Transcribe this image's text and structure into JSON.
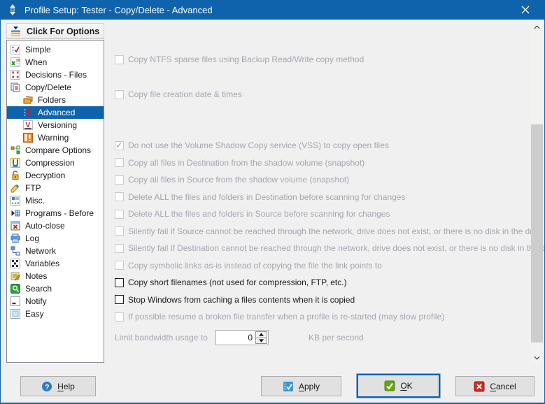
{
  "window": {
    "title": "Profile Setup: Tester - Copy/Delete - Advanced"
  },
  "options_button": {
    "label": "Click For Options"
  },
  "sidebar": {
    "items": [
      {
        "label": "Simple",
        "icon": "simple-icon",
        "indent": 0,
        "selected": false
      },
      {
        "label": "When",
        "icon": "when-icon",
        "indent": 0,
        "selected": false
      },
      {
        "label": "Decisions - Files",
        "icon": "decisions-files-icon",
        "indent": 0,
        "selected": false
      },
      {
        "label": "Copy/Delete",
        "icon": "copy-delete-icon",
        "indent": 0,
        "selected": false
      },
      {
        "label": "Folders",
        "icon": "folders-icon",
        "indent": 1,
        "selected": false
      },
      {
        "label": "Advanced",
        "icon": "advanced-icon",
        "indent": 1,
        "selected": true
      },
      {
        "label": "Versioning",
        "icon": "versioning-icon",
        "indent": 1,
        "selected": false
      },
      {
        "label": "Warning",
        "icon": "warning-icon",
        "indent": 1,
        "selected": false
      },
      {
        "label": "Compare Options",
        "icon": "compare-options-icon",
        "indent": 0,
        "selected": false
      },
      {
        "label": "Compression",
        "icon": "compression-icon",
        "indent": 0,
        "selected": false
      },
      {
        "label": "Decryption",
        "icon": "decryption-icon",
        "indent": 0,
        "selected": false
      },
      {
        "label": "FTP",
        "icon": "ftp-icon",
        "indent": 0,
        "selected": false
      },
      {
        "label": "Misc.",
        "icon": "misc-icon",
        "indent": 0,
        "selected": false
      },
      {
        "label": "Programs - Before",
        "icon": "programs-before-icon",
        "indent": 0,
        "selected": false
      },
      {
        "label": "Auto-close",
        "icon": "auto-close-icon",
        "indent": 0,
        "selected": false
      },
      {
        "label": "Log",
        "icon": "log-icon",
        "indent": 0,
        "selected": false
      },
      {
        "label": "Network",
        "icon": "network-icon",
        "indent": 0,
        "selected": false
      },
      {
        "label": "Variables",
        "icon": "variables-icon",
        "indent": 0,
        "selected": false
      },
      {
        "label": "Notes",
        "icon": "notes-icon",
        "indent": 0,
        "selected": false
      },
      {
        "label": "Search",
        "icon": "search-icon",
        "indent": 0,
        "selected": false
      },
      {
        "label": "Notify",
        "icon": "notify-icon",
        "indent": 0,
        "selected": false
      },
      {
        "label": "Easy",
        "icon": "easy-icon",
        "indent": 0,
        "selected": false
      }
    ]
  },
  "options": [
    {
      "label": "Copy NTFS sparse files using Backup Read/Write copy method",
      "checked": false,
      "enabled": false,
      "group": 1
    },
    {
      "label": "Copy file creation date & times",
      "checked": false,
      "enabled": false,
      "group": 2
    },
    {
      "label": "Do not use the Volume Shadow Copy service (VSS) to copy open files",
      "checked": true,
      "enabled": false,
      "group": 3
    },
    {
      "label": "Copy all files in Destination from the shadow volume (snapshot)",
      "checked": false,
      "enabled": false,
      "group": 3
    },
    {
      "label": "Copy all files in Source from the shadow volume (snapshot)",
      "checked": false,
      "enabled": false,
      "group": 3
    },
    {
      "label": "Delete ALL the files and folders in Destination before scanning for changes",
      "checked": false,
      "enabled": false,
      "group": 3
    },
    {
      "label": "Delete ALL the files and folders in Source before scanning for changes",
      "checked": false,
      "enabled": false,
      "group": 3
    },
    {
      "label": "Silently fail if Source cannot be reached through the network, drive does not exist, or there is no disk in the drive",
      "checked": false,
      "enabled": false,
      "group": 3
    },
    {
      "label": "Silently fail if Destination cannot be reached through the network, drive does not exist, or there is no disk in the drive",
      "checked": false,
      "enabled": false,
      "group": 3
    },
    {
      "label": "Copy symbolic links as-is instead of copying the file the link points to",
      "checked": false,
      "enabled": false,
      "group": 3
    },
    {
      "label": "Copy short filenames (not used for compression, FTP, etc.)",
      "checked": false,
      "enabled": true,
      "group": 3
    },
    {
      "label": "Stop Windows from caching a files contents when it is copied",
      "checked": false,
      "enabled": true,
      "group": 3
    },
    {
      "label": "If possible resume a broken file transfer when a profile is re-started (may slow profile)",
      "checked": false,
      "enabled": false,
      "group": 3
    }
  ],
  "bandwidth": {
    "label": "Limit bandwidth usage to",
    "value": "0",
    "unit": "KB per second"
  },
  "footer": {
    "buttons": [
      {
        "name": "help",
        "label": "Help",
        "accel": "H",
        "icon": "help-icon",
        "default": false
      },
      {
        "name": "apply",
        "label": "Apply",
        "accel": "A",
        "icon": "apply-icon",
        "default": false
      },
      {
        "name": "ok",
        "label": "OK",
        "accel": "O",
        "icon": "ok-icon",
        "default": true
      },
      {
        "name": "cancel",
        "label": "Cancel",
        "accel": "C",
        "icon": "cancel-icon",
        "default": false
      }
    ]
  },
  "colors": {
    "titlebar": "#0f63ac",
    "selection": "#0f63ac",
    "disabled_text": "#a3a7b0",
    "enabled_text": "#1a1a1a",
    "button_face": "#e1e1e1",
    "ok_focus_ring": "#0f63ac"
  }
}
